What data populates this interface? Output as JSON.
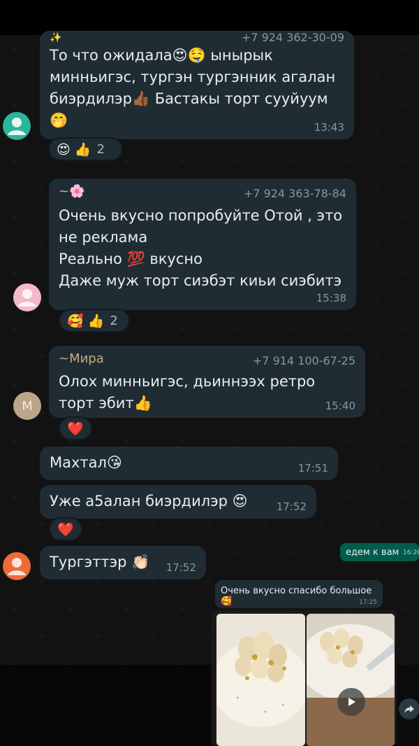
{
  "messages": {
    "m1": {
      "sender": "✨",
      "phone": "+7 924 362-30-09",
      "text": "То что ожидала😍🤤 ынырык минньигэс, тургэн тургэнник агалан биэрдилэр👍🏾 Бастакы торт сууйуум 🤭",
      "time": "13:43",
      "reaction": {
        "emojis": "😍 👍",
        "count": "2"
      }
    },
    "m2": {
      "sender": "~🌸",
      "phone": "+7 924 363-78-84",
      "text": "Очень вкусно попробуйте Отой , это не реклама\nРеально 💯 вкусно\nДаже муж торт сиэбэт киьи сиэбитэ",
      "time": "15:38",
      "reaction": {
        "emojis": "🥰 👍",
        "count": "2"
      }
    },
    "m3": {
      "sender": "~Мира",
      "phone": "+7 914 100-67-25",
      "avatar_letter": "М",
      "text": "Олох минньигэс, дьиннээх ретро торт эбит👍",
      "time": "15:40",
      "reaction": {
        "emojis": "❤️"
      }
    },
    "m4": {
      "text": "Махтал😘",
      "time": "17:51"
    },
    "m5": {
      "text": "Уже а5алан биэрдилэр 😍",
      "time": "17:52",
      "reaction": {
        "emojis": "❤️"
      }
    },
    "m6": {
      "text": "Тургэттэр 👏🏻",
      "time": "17:52"
    }
  },
  "embedded": {
    "sent_text": "едем к вам",
    "sent_time": "16:20",
    "message_text": "Очень вкусно спасибо большое 🥰",
    "message_time": "17:25"
  },
  "colors": {
    "bubble": "#202c33",
    "avatar_teal": "#2bb59b",
    "avatar_pink": "#f5b8c8",
    "avatar_orange": "#ef6a3a"
  },
  "icons": [
    "person-icon",
    "play-icon",
    "forward-icon"
  ]
}
